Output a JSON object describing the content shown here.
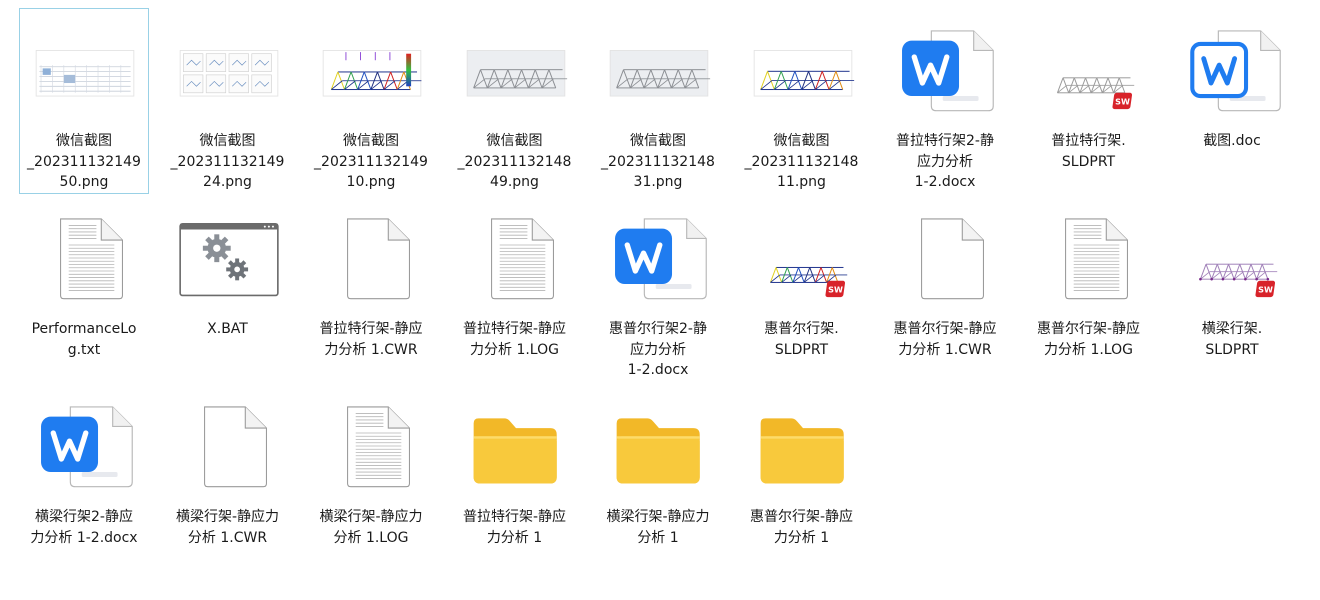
{
  "files": [
    {
      "id": "f1",
      "name": "微信截图\n_2023111321​49\n50.png",
      "type": "png-screenshot",
      "icon": "image-thumbnail-table-icon",
      "selected": true
    },
    {
      "id": "f2",
      "name": "微信截图\n_2023111321​49\n24.png",
      "type": "png-screenshot",
      "icon": "image-thumbnail-grid-icon"
    },
    {
      "id": "f3",
      "name": "微信截图\n_2023111321​49\n10.png",
      "type": "png-screenshot",
      "icon": "image-thumbnail-stress-icon"
    },
    {
      "id": "f4",
      "name": "微信截图\n_2023111321​48\n49.png",
      "type": "png-screenshot",
      "icon": "image-thumbnail-truss-icon"
    },
    {
      "id": "f5",
      "name": "微信截图\n_2023111321​48\n31.png",
      "type": "png-screenshot",
      "icon": "image-thumbnail-truss-icon"
    },
    {
      "id": "f6",
      "name": "微信截图\n_2023111321​48\n11.png",
      "type": "png-screenshot",
      "icon": "image-thumbnail-colored-truss-icon"
    },
    {
      "id": "f7",
      "name": "普拉特行架2-静\n应力分析\n1-2.docx",
      "type": "docx",
      "icon": "wps-writer-icon"
    },
    {
      "id": "f8",
      "name": "普拉特行架.\nSLDPRT",
      "type": "sldprt",
      "icon": "solidworks-part-icon"
    },
    {
      "id": "f9",
      "name": "截图.doc",
      "type": "doc",
      "icon": "wps-writer-outline-icon"
    },
    {
      "id": "f10",
      "name": "PerformanceLo\ng.txt",
      "type": "txt",
      "icon": "text-file-icon"
    },
    {
      "id": "f11",
      "name": "X.BAT",
      "type": "bat",
      "icon": "batch-gears-icon"
    },
    {
      "id": "f12",
      "name": "普拉特行架-静应\n力分析 1.CWR",
      "type": "cwr",
      "icon": "blank-file-icon"
    },
    {
      "id": "f13",
      "name": "普拉特行架-静应\n力分析 1.LOG",
      "type": "log",
      "icon": "text-file-icon"
    },
    {
      "id": "f14",
      "name": "惠普尔行架2-静\n应力分析\n1-2.docx",
      "type": "docx",
      "icon": "wps-writer-icon"
    },
    {
      "id": "f15",
      "name": "惠普尔行架.\nSLDPRT",
      "type": "sldprt",
      "icon": "solidworks-part-icon"
    },
    {
      "id": "f16",
      "name": "惠普尔行架-静应\n力分析 1.CWR",
      "type": "cwr",
      "icon": "blank-file-icon"
    },
    {
      "id": "f17",
      "name": "惠普尔行架-静应\n力分析 1.LOG",
      "type": "log",
      "icon": "text-file-icon"
    },
    {
      "id": "f18",
      "name": "横梁行架.\nSLDPRT",
      "type": "sldprt",
      "icon": "solidworks-part-icon"
    },
    {
      "id": "f19",
      "name": "横梁行架2-静应\n力分析 1-2.docx",
      "type": "docx",
      "icon": "wps-writer-icon"
    },
    {
      "id": "f20",
      "name": "横梁行架-静应力\n分析 1.CWR",
      "type": "cwr",
      "icon": "blank-file-icon"
    },
    {
      "id": "f21",
      "name": "横梁行架-静应力\n分析 1.LOG",
      "type": "log",
      "icon": "text-file-icon"
    },
    {
      "id": "f22",
      "name": "普拉特行架-静应\n力分析 1",
      "type": "folder",
      "icon": "folder-icon"
    },
    {
      "id": "f23",
      "name": "横梁行架-静应力\n分析 1",
      "type": "folder",
      "icon": "folder-icon"
    },
    {
      "id": "f24",
      "name": "惠普尔行架-静应\n力分析 1",
      "type": "folder",
      "icon": "folder-icon"
    }
  ],
  "colors": {
    "selection_border": "#99d1e6",
    "wps_blue": "#1f7cf0",
    "folder_yellow": "#f8c93c",
    "solidworks_red": "#d8232a"
  }
}
